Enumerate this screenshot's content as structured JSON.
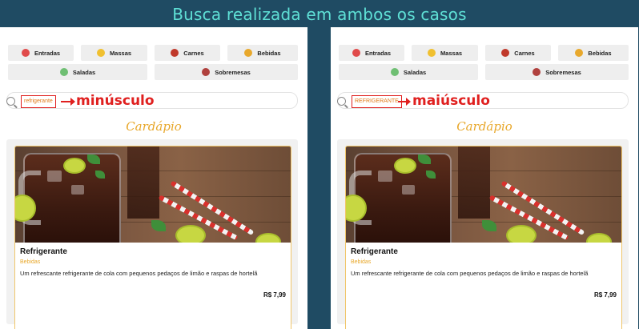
{
  "header": {
    "title": "Busca realizada em ambos os casos"
  },
  "categories": [
    {
      "label": "Entradas",
      "icon": "salad-plate-icon",
      "color": "#e04a4a"
    },
    {
      "label": "Massas",
      "icon": "pasta-icon",
      "color": "#f0c030"
    },
    {
      "label": "Carnes",
      "icon": "meat-icon",
      "color": "#c0392b"
    },
    {
      "label": "Bebidas",
      "icon": "drinks-icon",
      "color": "#e8a82c"
    },
    {
      "label": "Saladas",
      "icon": "salad-bowl-icon",
      "color": "#6fbf73"
    },
    {
      "label": "Sobremesas",
      "icon": "dessert-icon",
      "color": "#b0413e"
    }
  ],
  "left": {
    "search": {
      "value": "refrigerante"
    },
    "annotation": "minúsculo"
  },
  "right": {
    "search": {
      "value": "REFRIGERANTE"
    },
    "annotation": "maiúsculo"
  },
  "menu": {
    "section_title": "Cardápio"
  },
  "product": {
    "name": "Refrigerante",
    "category": "Bebidas",
    "description": "Um refrescante refrigerante de cola com pequenos pedaços de limão e raspas de hortelã",
    "price": "R$ 7,99"
  },
  "colors": {
    "background": "#1f4b63",
    "title": "#5fe0d6",
    "accent": "#e8a82c",
    "annotation": "#e0201f"
  }
}
